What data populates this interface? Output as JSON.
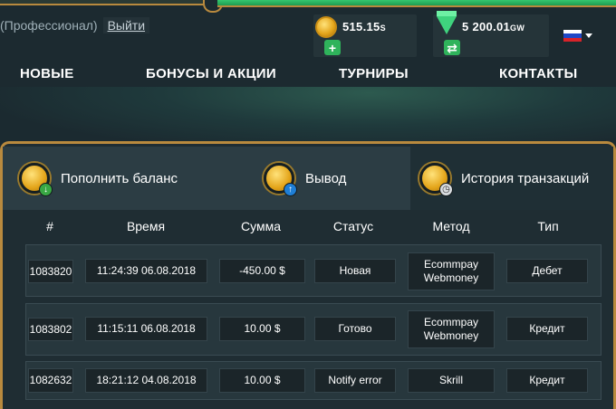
{
  "user": {
    "level_text": "(Профессионал)",
    "logout_label": "Выйти"
  },
  "wallets": {
    "coins": {
      "amount": "515.15",
      "unit": "S",
      "action_icon": "plus-icon",
      "action_glyph": "+"
    },
    "gems": {
      "amount": "5 200.01",
      "unit": "GW",
      "action_icon": "exchange-icon",
      "action_glyph": "⇄"
    }
  },
  "language": {
    "flag": "ru-flag",
    "colors": [
      "#ffffff",
      "#1f47c6",
      "#d8232a"
    ]
  },
  "nav": {
    "items": [
      {
        "label": "НОВЫЕ"
      },
      {
        "label": "БОНУСЫ И АКЦИИ"
      },
      {
        "label": "ТУРНИРЫ"
      },
      {
        "label": "КОНТАКТЫ"
      }
    ]
  },
  "tabs": [
    {
      "label": "Пополнить баланс",
      "badge_icon": "arrow-down-icon",
      "badge_glyph": "↓",
      "badge_color": "#39a844",
      "active": false
    },
    {
      "label": "Вывод",
      "badge_icon": "arrow-up-icon",
      "badge_glyph": "↑",
      "badge_color": "#1f7fd6",
      "active": false
    },
    {
      "label": "История транзакций",
      "badge_icon": "clock-icon",
      "badge_glyph": "◷",
      "badge_color": "#d9dde0",
      "active": true
    }
  ],
  "table": {
    "headers": [
      "#",
      "Время",
      "Сумма",
      "Статус",
      "Метод",
      "Тип"
    ],
    "rows": [
      {
        "id": "1083820",
        "time": "11:24:39 06.08.2018",
        "amount": "-450.00 $",
        "status": "Новая",
        "method_1": "Ecommpay",
        "method_2": "Webmoney",
        "type": "Дебет"
      },
      {
        "id": "1083802",
        "time": "11:15:11 06.08.2018",
        "amount": "10.00 $",
        "status": "Готово",
        "method_1": "Ecommpay",
        "method_2": "Webmoney",
        "type": "Кредит"
      },
      {
        "id": "1082632",
        "time": "18:21:12 04.08.2018",
        "amount": "10.00 $",
        "status": "Notify error",
        "method_1": "Skrill",
        "method_2": "",
        "type": "Кредит"
      }
    ]
  },
  "colors": {
    "accent_gold": "#b98a3e",
    "accent_green": "#2fb35b",
    "panel_bg": "#1f2d33"
  }
}
